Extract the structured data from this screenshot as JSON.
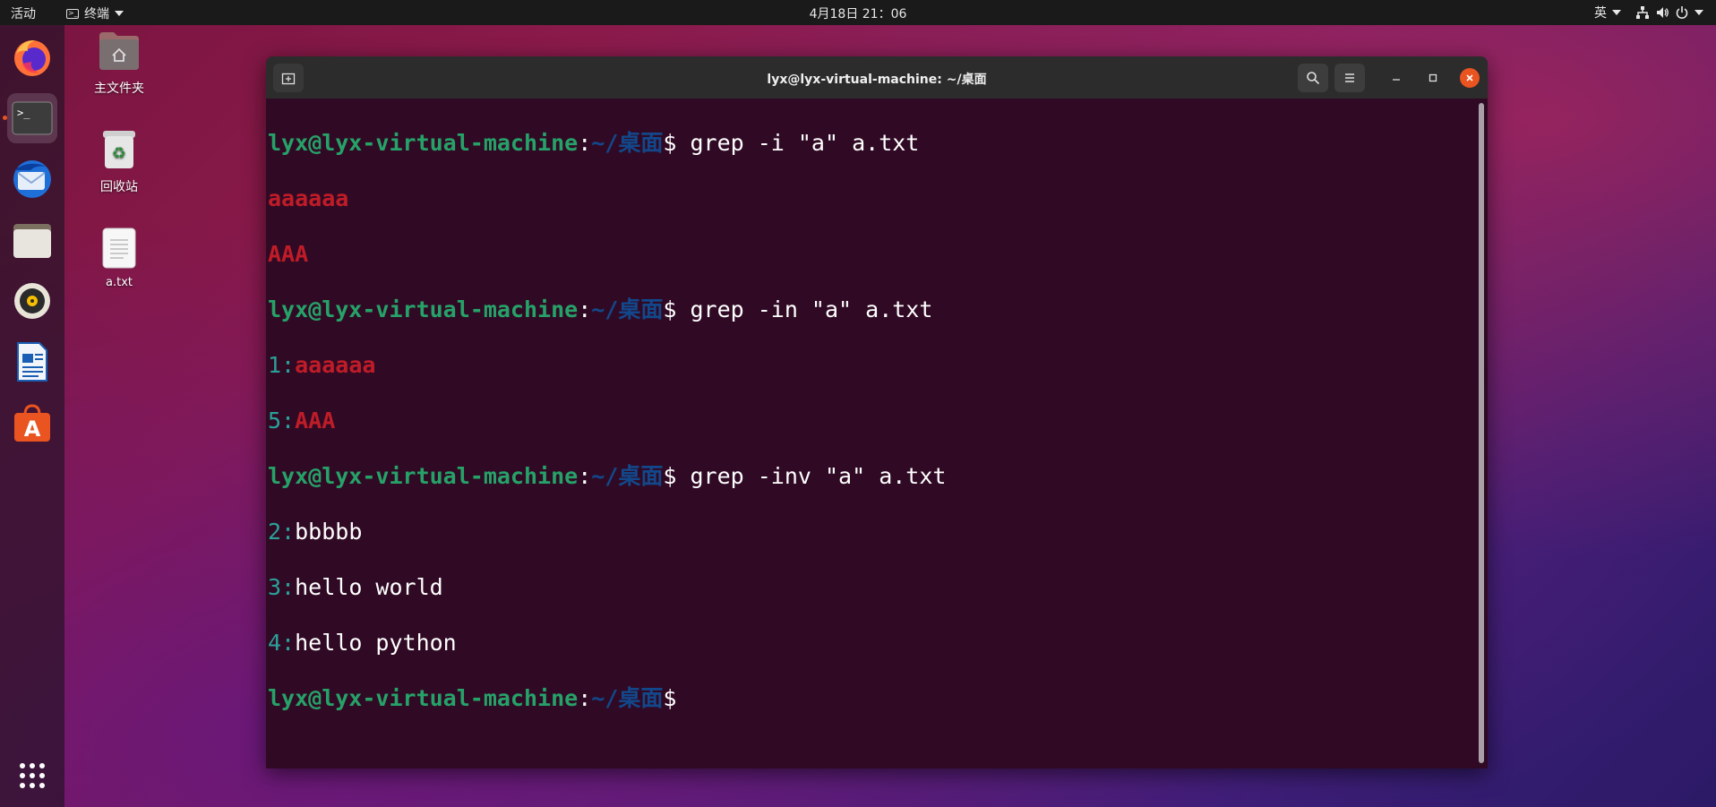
{
  "topbar": {
    "activities": "活动",
    "app_menu": "终端",
    "clock": "4月18日  21：06",
    "input_method": "英"
  },
  "desktop": {
    "icons": [
      {
        "label": "主文件夹",
        "icon": "home-folder-icon"
      },
      {
        "label": "回收站",
        "icon": "trash-icon"
      },
      {
        "label": "a.txt",
        "icon": "text-file-icon"
      }
    ]
  },
  "dock": {
    "apps": [
      "firefox",
      "terminal",
      "thunderbird",
      "files",
      "rhythmbox",
      "libreoffice-writer",
      "software-center"
    ],
    "active": "terminal"
  },
  "terminal": {
    "title": "lyx@lyx-virtual-machine: ~/桌面",
    "prompt_user": "lyx@lyx-virtual-machine",
    "prompt_sep": ":",
    "prompt_path": "~/桌面",
    "prompt_symbol": "$",
    "lines": {
      "cmd1": " grep -i \"a\" a.txt",
      "out1": "aaaaaa",
      "out2": "AAA",
      "cmd2": " grep -in \"a\" a.txt",
      "out3_num": "1:",
      "out3_text": "aaaaaa",
      "out4_num": "5:",
      "out4_text": "AAA",
      "cmd3": " grep -inv \"a\" a.txt",
      "out5_num": "2:",
      "out5_text": "bbbbb",
      "out6_num": "3:",
      "out6_text": "hello world",
      "out7_num": "4:",
      "out7_text": "hello python"
    }
  },
  "colors": {
    "terminal_bg": "#300a24",
    "prompt_user": "#26a269",
    "prompt_path": "#12488b",
    "match": "#c01c28",
    "line_number": "#2aa198",
    "close_button": "#e95420"
  }
}
